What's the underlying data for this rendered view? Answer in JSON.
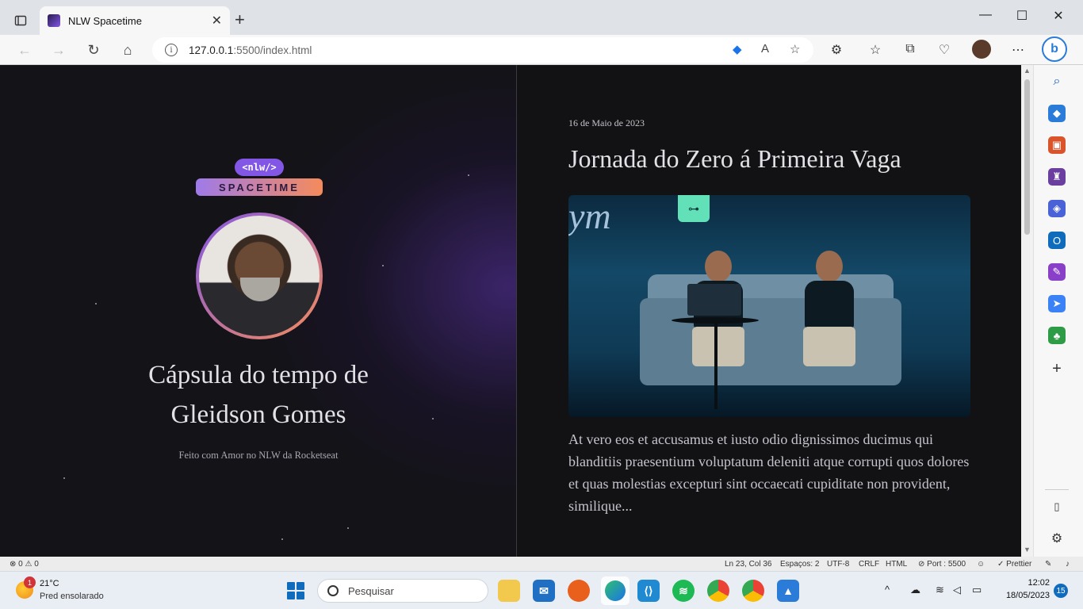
{
  "browser": {
    "tab_title": "NLW Spacetime",
    "url_host": "127.0.0.1",
    "url_rest": ":5500/index.html",
    "window_controls": {
      "minimize": "—",
      "maximize": "☐",
      "close": "✕"
    },
    "new_tab": "+"
  },
  "page": {
    "logo_top": "<nlw/>",
    "logo_bottom": "SPACETIME",
    "capsule_title": "Cápsula do tempo de Gleidson Gomes",
    "footer": "Feito com Amor no NLW da Rocketseat",
    "post": {
      "date": "16 de Maio de 2023",
      "title": "Jornada do Zero á Primeira Vaga",
      "excerpt": "At vero eos et accusamus et iusto odio dignissimos ducimus qui blanditiis praesentium voluptatum deleniti atque corrupti quos dolores et quas molestias excepturi sint occaecati cupiditate non provident, similique..."
    }
  },
  "statusbar": {
    "errors": "⊗ 0 ⚠ 0",
    "position": "Ln 23, Col 36",
    "spaces": "Espaços: 2",
    "encoding": "UTF-8",
    "eol": "CRLF",
    "language": "HTML",
    "port": "⊘ Port : 5500",
    "prettier": "✓ Prettier"
  },
  "taskbar": {
    "weather_temp": "21°C",
    "weather_desc": "Pred ensolarado",
    "weather_badge": "1",
    "search_placeholder": "Pesquisar",
    "time": "12:02",
    "date": "18/05/2023",
    "notifications": "15"
  }
}
